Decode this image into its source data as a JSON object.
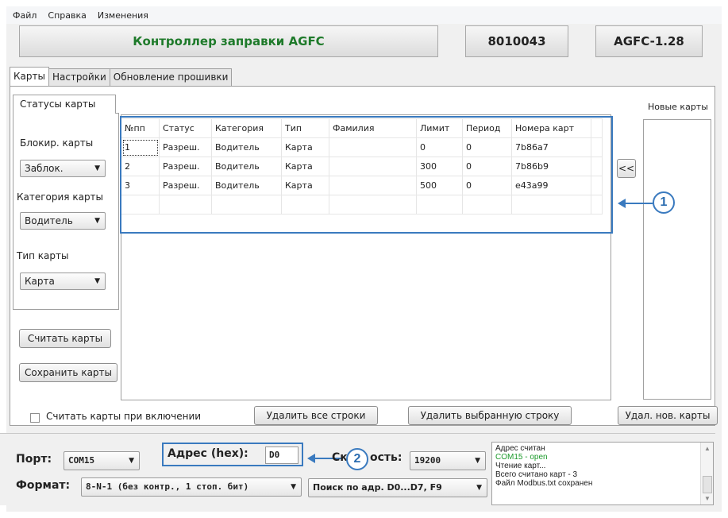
{
  "menu": [
    "Файл",
    "Справка",
    "Изменения"
  ],
  "header": {
    "title": "Контроллер заправки AGFC",
    "serial": "8010043",
    "version": "AGFC-1.28"
  },
  "tabs": [
    "Карты",
    "Настройки",
    "Обновление прошивки"
  ],
  "inner_tab": "Статусы карты",
  "left_panel": {
    "block_label": "Блокир. карты",
    "block_value": "Заблок.",
    "category_label": "Категория карты",
    "category_value": "Водитель",
    "type_label": "Тип карты",
    "type_value": "Карта"
  },
  "buttons": {
    "read_cards": "Считать карты",
    "save_cards": "Сохранить карты",
    "delete_all": "Удалить все строки",
    "delete_selected": "Удалить выбранную строку",
    "delete_new": "Удал. нов. карты",
    "move_left": "<<"
  },
  "read_on_start_label": "Считать карты при включении",
  "new_cards_label": "Новые карты",
  "table": {
    "columns": [
      "№пп",
      "Статус",
      "Категория",
      "Тип",
      "Фамилия",
      "Лимит",
      "Период",
      "Номера карт"
    ],
    "rows": [
      [
        "1",
        "Разреш.",
        "Водитель",
        "Карта",
        "",
        "0",
        "0",
        "7b86a7"
      ],
      [
        "2",
        "Разреш.",
        "Водитель",
        "Карта",
        "",
        "300",
        "0",
        "7b86b9"
      ],
      [
        "3",
        "Разреш.",
        "Водитель",
        "Карта",
        "",
        "500",
        "0",
        "e43a99"
      ],
      [
        "",
        "",
        "",
        "",
        "",
        "",
        "",
        ""
      ]
    ]
  },
  "callouts": [
    "1",
    "2"
  ],
  "bottom": {
    "port_label": "Порт:",
    "port_value": "COM15",
    "address_label": "Адрес (hex):",
    "address_value": "D0",
    "speed_label_start": "Ск",
    "speed_label_end": "ость:",
    "speed_value": "19200",
    "format_label": "Формат:",
    "format_value": "8-N-1 (без контр., 1 стоп. бит)",
    "search_value": "Поиск по адр. D0...D7, F9"
  },
  "log": [
    {
      "text": "Адрес считан",
      "color": "#222222"
    },
    {
      "text": "COM15 - open",
      "color": "#1d9b2c"
    },
    {
      "text": "Чтение карт...",
      "color": "#222222"
    },
    {
      "text": "Всего считано карт - 3",
      "color": "#222222"
    },
    {
      "text": "Файл Modbus.txt сохранен",
      "color": "#222222"
    }
  ],
  "colors": {
    "accent": "#3a7abf",
    "title_green": "#1e7a2a"
  }
}
